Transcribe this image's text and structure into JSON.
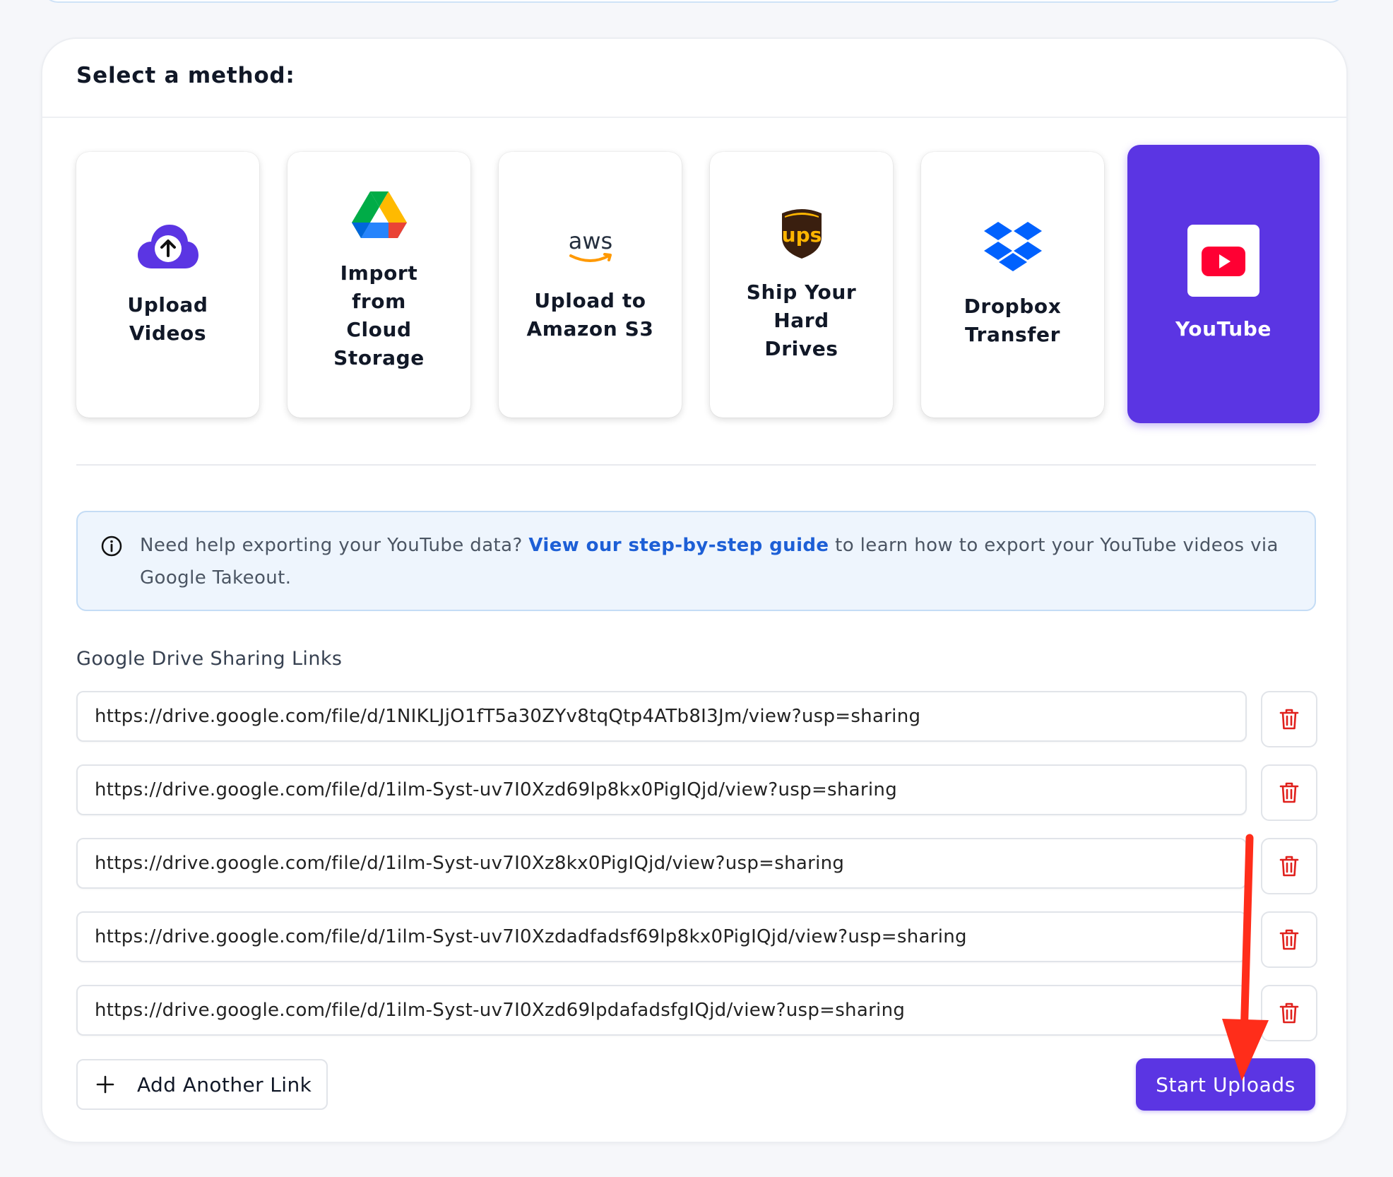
{
  "card": {
    "title": "Select a method:"
  },
  "methods": [
    {
      "label": "Upload Videos",
      "icon": "cloud-upload-icon",
      "selected": false
    },
    {
      "label": "Import from Cloud Storage",
      "icon": "google-drive-icon",
      "selected": false
    },
    {
      "label": "Upload to Amazon S3",
      "icon": "aws-icon",
      "selected": false
    },
    {
      "label": "Ship Your Hard Drives",
      "icon": "ups-icon",
      "selected": false
    },
    {
      "label": "Dropbox Transfer",
      "icon": "dropbox-icon",
      "selected": false
    },
    {
      "label": "YouTube",
      "icon": "youtube-icon",
      "selected": true
    }
  ],
  "aws_logo_text": "aws",
  "ups_logo_text": "ups",
  "info": {
    "before": "Need help exporting your YouTube data?",
    "link": "View our step-by-step guide",
    "after": "to learn how to export your YouTube videos via Google Takeout."
  },
  "links_section": {
    "label": "Google Drive Sharing Links",
    "links": [
      "https://drive.google.com/file/d/1NIKLJjO1fT5a30ZYv8tqQtp4ATb8I3Jm/view?usp=sharing",
      "https://drive.google.com/file/d/1ilm-Syst-uv7I0Xzd69lp8kx0PigIQjd/view?usp=sharing",
      "https://drive.google.com/file/d/1ilm-Syst-uv7I0Xz8kx0PigIQjd/view?usp=sharing",
      "https://drive.google.com/file/d/1ilm-Syst-uv7I0Xzdadfadsf69lp8kx0PigIQjd/view?usp=sharing",
      "https://drive.google.com/file/d/1ilm-Syst-uv7I0Xzd69lpdafadsfgIQjd/view?usp=sharing"
    ]
  },
  "actions": {
    "add_label": "Add Another Link",
    "start_label": "Start Uploads"
  },
  "colors": {
    "accent": "#5b35e3",
    "link": "#1d5fd6",
    "delete": "#e0201c",
    "annotation": "#ff2d1a"
  }
}
